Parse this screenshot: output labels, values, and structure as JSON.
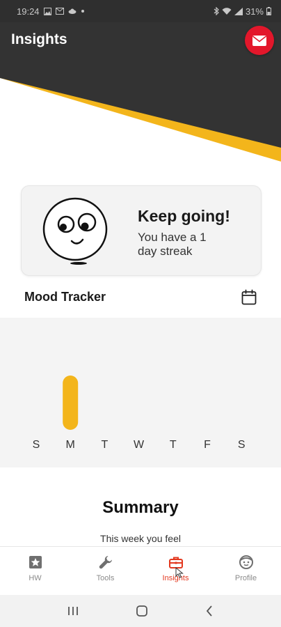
{
  "status_bar": {
    "time": "19:24",
    "battery": "31%",
    "icons": [
      "image-icon",
      "mail-icon",
      "cloud-icon",
      "dot-icon",
      "bluetooth-icon",
      "wifi-icon",
      "signal-icon",
      "battery-icon"
    ]
  },
  "header": {
    "title": "Insights",
    "mail_icon": "envelope-icon",
    "colors": {
      "dark": "#333333",
      "accent": "#f3b51b",
      "mail": "#e3172b"
    }
  },
  "streak_card": {
    "title": "Keep going!",
    "text": "You have a 1 day streak",
    "icon": "smiley-face-icon"
  },
  "mood_tracker": {
    "title": "Mood Tracker",
    "calendar_icon": "calendar-icon"
  },
  "chart_data": {
    "type": "bar",
    "categories": [
      "S",
      "M",
      "T",
      "W",
      "T",
      "F",
      "S"
    ],
    "values": [
      0,
      1,
      0,
      0,
      0,
      0,
      0
    ],
    "title": "",
    "xlabel": "",
    "ylabel": "",
    "ylim": [
      0,
      1
    ],
    "grid": false,
    "bar_color": "#f3b51b"
  },
  "summary": {
    "title": "Summary",
    "subtitle": "This week you feel"
  },
  "bottom_nav": {
    "items": [
      {
        "label": "HW",
        "icon": "star-icon",
        "active": false
      },
      {
        "label": "Tools",
        "icon": "wrench-icon",
        "active": false
      },
      {
        "label": "Insights",
        "icon": "toolbox-icon",
        "active": true
      },
      {
        "label": "Profile",
        "icon": "face-icon",
        "active": false
      }
    ],
    "active_color": "#e3381f"
  },
  "system_nav": {
    "buttons": [
      "recent-apps-icon",
      "home-icon",
      "back-icon"
    ]
  }
}
